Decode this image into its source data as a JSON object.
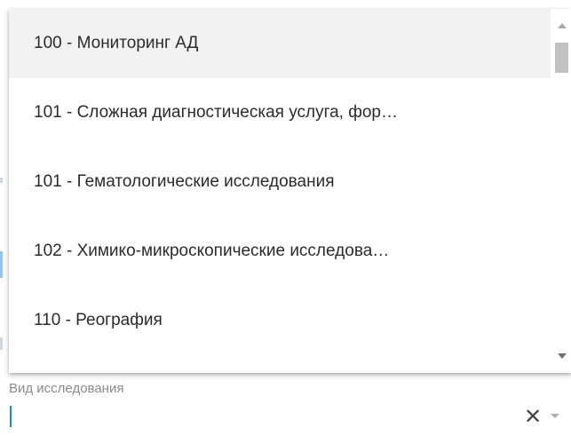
{
  "dropdown": {
    "options": [
      {
        "label": "100 - Мониторинг АД",
        "highlighted": true
      },
      {
        "label": "101 - Сложная диагностическая услуга, фор…",
        "highlighted": false
      },
      {
        "label": "101 - Гематологические исследования",
        "highlighted": false
      },
      {
        "label": "102 - Химико-микроскопические исследова…",
        "highlighted": false
      },
      {
        "label": "110 - Реография",
        "highlighted": false
      }
    ]
  },
  "field": {
    "label": "Вид исследования",
    "value": "",
    "clear_symbol": "✕"
  },
  "icons": {
    "clear": "close-icon",
    "toggle": "chevron-down-icon",
    "scroll_up": "arrow-up-icon",
    "scroll_down": "arrow-down-icon"
  },
  "colors": {
    "highlight_bg": "#f2f2f2",
    "caret": "#1e88e5",
    "label_text": "#8a8a8a",
    "option_text": "#2b2b2b"
  }
}
